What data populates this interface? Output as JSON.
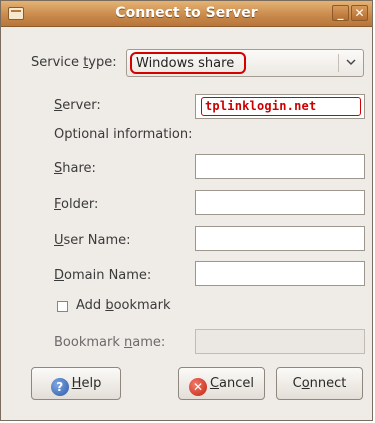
{
  "window": {
    "title": "Connect to Server"
  },
  "service": {
    "label_pre": "Service ",
    "label_underlined": "t",
    "label_post": "ype:",
    "value": "Windows share"
  },
  "server": {
    "label_underlined": "S",
    "label_post": "erver:",
    "value": "tplinklogin.net"
  },
  "optional_info": "Optional information:",
  "share": {
    "label_underlined": "S",
    "label_post": "hare:",
    "value": ""
  },
  "folder": {
    "label_underlined": "F",
    "label_post": "older:",
    "value": ""
  },
  "user_name": {
    "label_underlined": "U",
    "label_post": "ser Name:",
    "value": ""
  },
  "domain_name": {
    "label_underlined": "D",
    "label_post": "omain Name:",
    "value": ""
  },
  "add_bookmark": {
    "label_pre": "Add ",
    "label_underlined": "b",
    "label_post": "ookmark",
    "checked": false
  },
  "bookmark_name": {
    "label_pre": "Bookmark ",
    "label_underlined": "n",
    "label_post": "ame:",
    "value": ""
  },
  "buttons": {
    "help": {
      "underlined": "H",
      "rest": "elp"
    },
    "cancel": {
      "underlined": "C",
      "rest": "ancel"
    },
    "connect": {
      "pre": "C",
      "underlined": "o",
      "rest": "nnect"
    }
  },
  "icons": {
    "window_menu": "window-menu-icon",
    "minimize": "minimize-icon",
    "close": "close-icon",
    "dropdown": "chevron-down-icon",
    "help": "help-icon",
    "cancel": "cancel-icon"
  }
}
